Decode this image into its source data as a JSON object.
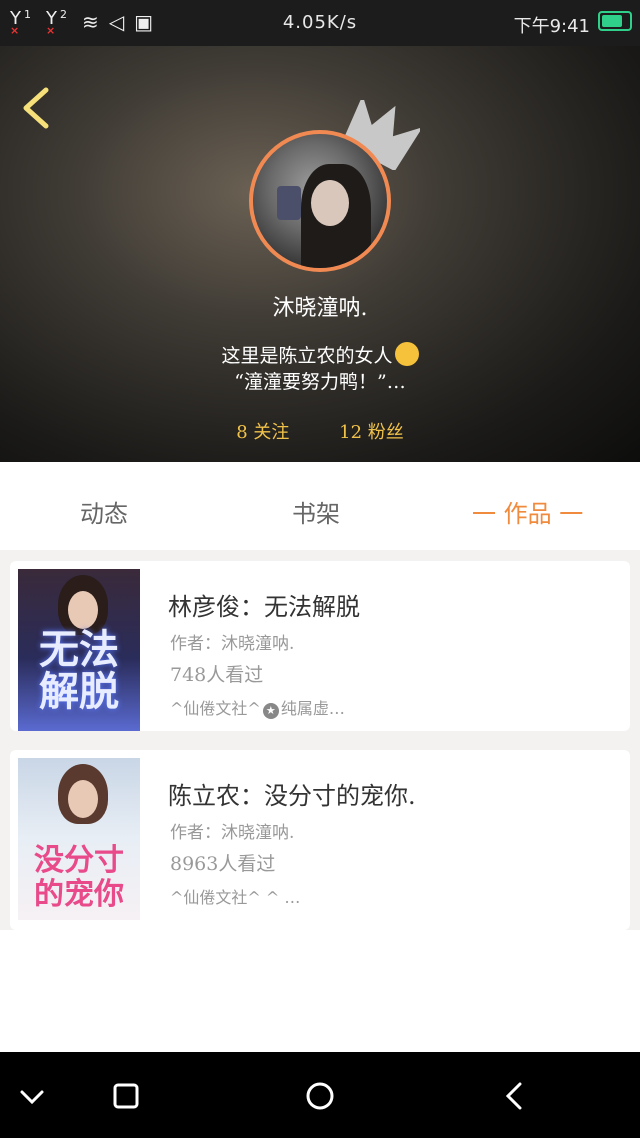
{
  "status_bar": {
    "sim1": "1",
    "sim2": "2",
    "speed": "4.05K/s",
    "time": "下午9:41",
    "battery_color": "#2fd18a"
  },
  "profile": {
    "username": "沐晓潼呐.",
    "bio_line1": "这里是陈立农的女人",
    "bio_line2": "“潼潼要努力鸭！”…",
    "following": "8 关注",
    "followers": "12 粉丝",
    "accent_color": "#f08a52"
  },
  "tabs": [
    {
      "label": "动态"
    },
    {
      "label": "书架"
    },
    {
      "label": "一 作品 一",
      "active": true
    }
  ],
  "books": [
    {
      "title": "林彦俊：无法解脱",
      "author": "作者：沐晓潼呐.",
      "views": "748人看过",
      "tag_a": "^仙倦文社^",
      "tag_b": "纯属虚…",
      "cover_text": "无法解脱"
    },
    {
      "title": "陈立农：没分寸的宠你.",
      "author": "作者：沐晓潼呐.",
      "views": "8963人看过",
      "tags": "^仙倦文社^ ^ …",
      "cover_text": "没分寸的宠你"
    }
  ],
  "icons": {
    "back": "chevron-left-icon",
    "crown": "crown-icon",
    "nav_down": "chevron-down-icon",
    "nav_recent": "square-icon",
    "nav_home": "circle-icon",
    "nav_back": "triangle-back-icon"
  }
}
